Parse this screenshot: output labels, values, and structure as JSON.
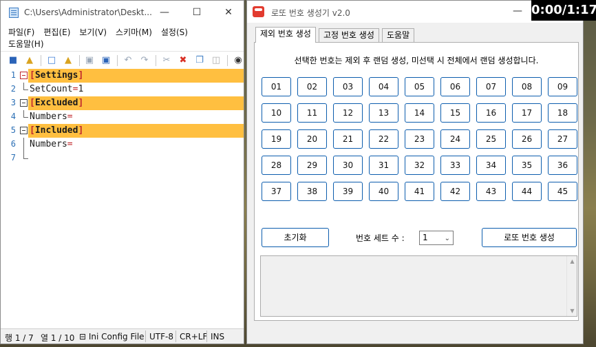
{
  "notepad": {
    "title": "C:\\Users\\Administrator\\Deskt...",
    "menu_row1": [
      "파일(F)",
      "편집(E)",
      "보기(V)",
      "스키마(M)",
      "설정(S)"
    ],
    "menu_row2": [
      "도움말(H)"
    ],
    "lines": [
      {
        "num": "1",
        "bracket_open": "[",
        "section": "Settings",
        "bracket_close": "]"
      },
      {
        "num": "2",
        "key": "SetCount",
        "eq": "=",
        "value": "1"
      },
      {
        "num": "3",
        "bracket_open": "[",
        "section": "Excluded",
        "bracket_close": "]"
      },
      {
        "num": "4",
        "key": "Numbers",
        "eq": "=",
        "value": ""
      },
      {
        "num": "5",
        "bracket_open": "[",
        "section": "Included",
        "bracket_close": "]"
      },
      {
        "num": "6",
        "key": "Numbers",
        "eq": "=",
        "value": ""
      },
      {
        "num": "7"
      }
    ],
    "status": {
      "line": "행 1 / 7",
      "col": "열 1 / 10",
      "schema": "⊟ Ini Config File",
      "encoding": "UTF-8",
      "eol": "CR+LF",
      "mode": "INS"
    }
  },
  "lotto": {
    "title": "로또 번호 생성기 v2.0",
    "logo_text": "lotto",
    "tabs": [
      "제외 번호 생성",
      "고정 번호 생성",
      "도움말"
    ],
    "instruction": "선택한 번호는 제외 후 랜덤 생성, 미선택 시 전체에서 랜덤 생성합니다.",
    "numbers": [
      "01",
      "02",
      "03",
      "04",
      "05",
      "06",
      "07",
      "08",
      "09",
      "10",
      "11",
      "12",
      "13",
      "14",
      "15",
      "16",
      "17",
      "18",
      "19",
      "20",
      "21",
      "22",
      "23",
      "24",
      "25",
      "26",
      "27",
      "28",
      "29",
      "30",
      "31",
      "32",
      "33",
      "34",
      "35",
      "36",
      "37",
      "38",
      "39",
      "40",
      "41",
      "42",
      "43",
      "44",
      "45"
    ],
    "reset_label": "초기화",
    "set_label": "번호 세트 수 :",
    "set_value": "1",
    "generate_label": "로또 번호 생성",
    "output_text": ""
  },
  "timer": "0:00/1:17",
  "colors": {
    "highlight": "#ffbf40",
    "bracket": "#c0282d",
    "line_number": "#2b6fb5",
    "button_border": "#0b5cad"
  }
}
